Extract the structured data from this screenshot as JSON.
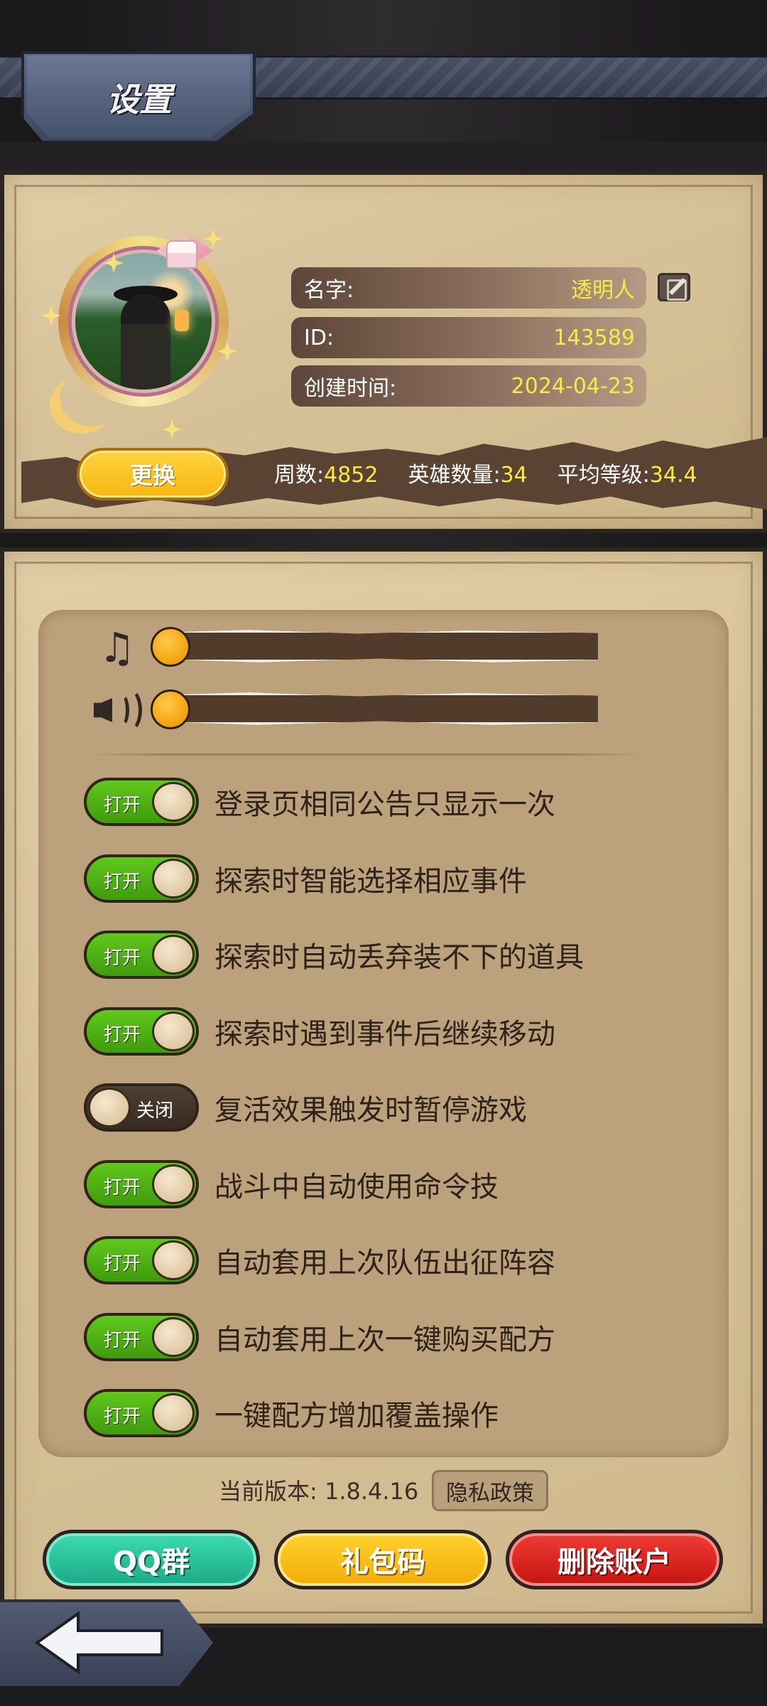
{
  "header": {
    "title": "设置"
  },
  "profile": {
    "name_label": "名字:",
    "name_value": "透明人",
    "id_label": "ID:",
    "id_value": "143589",
    "created_label": "创建时间:",
    "created_value": "2024-04-23",
    "change_button": "更换",
    "stats": [
      {
        "label": "周数:",
        "value": "4852"
      },
      {
        "label": "英雄数量:",
        "value": "34"
      },
      {
        "label": "平均等级:",
        "value": "34.4"
      }
    ]
  },
  "audio": {
    "music_icon": "music-note-icon",
    "sound_icon": "speaker-icon",
    "music_level": 0,
    "sound_level": 0
  },
  "toggles": [
    {
      "state": "on",
      "state_text": "打开",
      "label": "登录页相同公告只显示一次"
    },
    {
      "state": "on",
      "state_text": "打开",
      "label": "探索时智能选择相应事件"
    },
    {
      "state": "on",
      "state_text": "打开",
      "label": "探索时自动丢弃装不下的道具"
    },
    {
      "state": "on",
      "state_text": "打开",
      "label": "探索时遇到事件后继续移动"
    },
    {
      "state": "off",
      "state_text": "关闭",
      "label": "复活效果触发时暂停游戏"
    },
    {
      "state": "on",
      "state_text": "打开",
      "label": "战斗中自动使用命令技"
    },
    {
      "state": "on",
      "state_text": "打开",
      "label": "自动套用上次队伍出征阵容"
    },
    {
      "state": "on",
      "state_text": "打开",
      "label": "自动套用上次一键购买配方"
    },
    {
      "state": "on",
      "state_text": "打开",
      "label": "一键配方增加覆盖操作"
    }
  ],
  "footer": {
    "version_text": "当前版本: 1.8.4.16",
    "privacy_button": "隐私政策",
    "qq_button": "QQ群",
    "gift_button": "礼包码",
    "delete_button": "删除账户"
  },
  "colors": {
    "toggle_on": "#4fb515",
    "toggle_off": "#3f3128",
    "highlight_value": "#fbea45",
    "panel": "#d7c29a"
  }
}
